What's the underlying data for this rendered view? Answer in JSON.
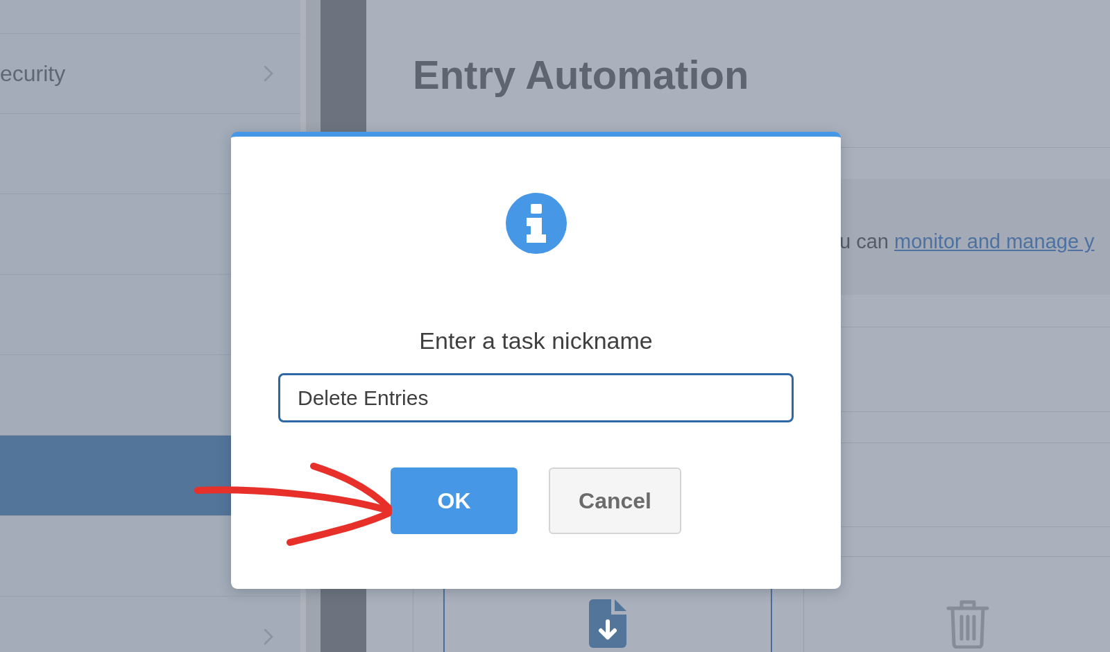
{
  "sidebar": {
    "items": [
      {
        "label": "ecurity",
        "kind": "submenu",
        "selected": false
      },
      {
        "kind": "plain",
        "selected": false
      },
      {
        "kind": "plain",
        "selected": false
      },
      {
        "kind": "plain",
        "selected": false
      },
      {
        "kind": "plain",
        "selected": false
      },
      {
        "kind": "plain",
        "selected": true
      },
      {
        "kind": "plain",
        "selected": false
      },
      {
        "kind": "submenu",
        "selected": false
      }
    ]
  },
  "page": {
    "title": "Entry Automation",
    "notice": {
      "prefix": "u can",
      "link": "monitor and manage y"
    }
  },
  "tasks": [
    {
      "kind": "download",
      "selected": true
    },
    {
      "kind": "delete",
      "selected": false
    }
  ],
  "dialog": {
    "title": "Enter a task nickname",
    "input": {
      "value": "Delete Entries"
    },
    "buttons": [
      {
        "label": "OK",
        "kind": "primary"
      },
      {
        "label": "Cancel",
        "kind": "secondary"
      }
    ]
  }
}
